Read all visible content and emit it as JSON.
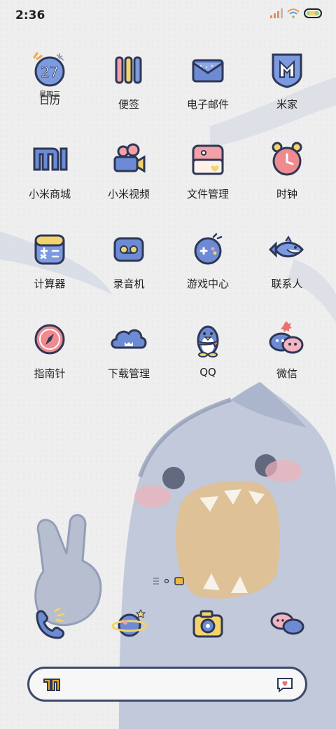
{
  "status_bar": {
    "time": "2:36",
    "icons": [
      "signal-icon",
      "wifi-icon",
      "battery-icon"
    ]
  },
  "apps": [
    {
      "label": "日历",
      "icon": "calendar-icon",
      "date": "27",
      "weekday": "星期三"
    },
    {
      "label": "便签",
      "icon": "notes-icon"
    },
    {
      "label": "电子邮件",
      "icon": "mail-icon"
    },
    {
      "label": "米家",
      "icon": "mijia-icon"
    },
    {
      "label": "小米商城",
      "icon": "mi-store-icon"
    },
    {
      "label": "小米视频",
      "icon": "video-camera-icon"
    },
    {
      "label": "文件管理",
      "icon": "file-manager-icon"
    },
    {
      "label": "时钟",
      "icon": "alarm-clock-icon"
    },
    {
      "label": "计算器",
      "icon": "calculator-icon"
    },
    {
      "label": "录音机",
      "icon": "recorder-icon"
    },
    {
      "label": "游戏中心",
      "icon": "gamepad-icon"
    },
    {
      "label": "联系人",
      "icon": "fish-icon"
    },
    {
      "label": "指南针",
      "icon": "compass-icon"
    },
    {
      "label": "下载管理",
      "icon": "cloud-download-icon"
    },
    {
      "label": "QQ",
      "icon": "penguin-icon"
    },
    {
      "label": "微信",
      "icon": "wechat-icon"
    }
  ],
  "dock": [
    "phone-icon",
    "planet-browser-icon",
    "camera-icon",
    "chat-bubbles-icon"
  ],
  "pager": [
    "list-page-icon",
    "page-dot",
    "current-page-icon"
  ],
  "search_bar": {
    "left_icon": "logo-icon",
    "right_icon": "heart-message-icon"
  },
  "colors": {
    "accent_blue": "#6f8fd8",
    "outline": "#2d3756",
    "pink": "#f3a0a8",
    "yellow": "#f3d36a"
  }
}
